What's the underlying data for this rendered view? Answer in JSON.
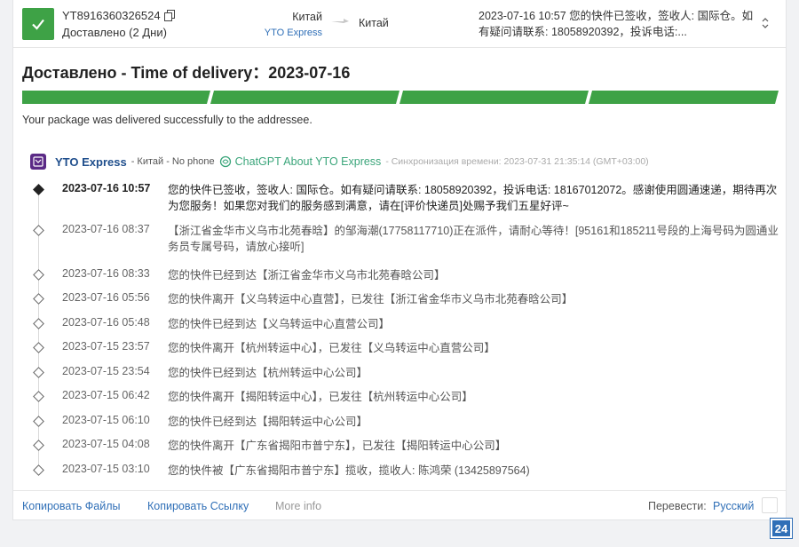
{
  "header": {
    "tracking_number": "YT8916360326524",
    "status": "Доставлено (2 Дни)",
    "origin_country": "Китай",
    "carrier_link": "YTO Express",
    "destination_country": "Китай",
    "last_event": "2023-07-16 10:57  您的快件已签收，签收人: 国际仓。如有疑问请联系: 18058920392，投诉电话:..."
  },
  "summary": {
    "title": "Доставлено - Time of delivery：2023-07-16",
    "progress_segments": 5,
    "progress_color": "#3ea246",
    "message": "Your package was delivered successfully to the addressee."
  },
  "carrier": {
    "name": "YTO Express",
    "meta": "- Китай - No phone",
    "chatgpt_link": "ChatGPT About YTO Express",
    "sync": "- Синхронизация времени: 2023-07-31 21:35:14 (GMT+03:00)"
  },
  "events": [
    {
      "time": "2023-07-16 10:57",
      "desc": "您的快件已签收，签收人: 国际仓。如有疑问请联系: 18058920392，投诉电话: 18167012072。感谢使用圆通速递，期待再次为您服务！如果您对我们的服务感到满意，请在[评价快递员]处赐予我们五星好评~"
    },
    {
      "time": "2023-07-16 08:37",
      "desc": "【浙江省金华市义乌市北苑春晗】的邹海潮(17758117710)正在派件，请耐心等待！[95161和185211号段的上海号码为圆通业务员专属号码，请放心接听]"
    },
    {
      "time": "2023-07-16 08:33",
      "desc": "您的快件已经到达【浙江省金华市义乌市北苑春晗公司】"
    },
    {
      "time": "2023-07-16 05:56",
      "desc": "您的快件离开【义乌转运中心直营】，已发往【浙江省金华市义乌市北苑春晗公司】"
    },
    {
      "time": "2023-07-16 05:48",
      "desc": "您的快件已经到达【义乌转运中心直营公司】"
    },
    {
      "time": "2023-07-15 23:57",
      "desc": "您的快件离开【杭州转运中心】，已发往【义乌转运中心直营公司】"
    },
    {
      "time": "2023-07-15 23:54",
      "desc": "您的快件已经到达【杭州转运中心公司】"
    },
    {
      "time": "2023-07-15 06:42",
      "desc": "您的快件离开【揭阳转运中心】，已发往【杭州转运中心公司】"
    },
    {
      "time": "2023-07-15 06:10",
      "desc": "您的快件已经到达【揭阳转运中心公司】"
    },
    {
      "time": "2023-07-15 04:08",
      "desc": "您的快件离开【广东省揭阳市普宁东】，已发往【揭阳转运中心公司】"
    },
    {
      "time": "2023-07-15 03:10",
      "desc": "您的快件被【广东省揭阳市普宁东】揽收，揽收人: 陈鸿荣 (13425897564)"
    }
  ],
  "footer": {
    "copy_files": "Копировать Файлы",
    "copy_link": "Копировать Ссылку",
    "more_info": "More info",
    "translate_label": "Перевести:",
    "translate_lang": "Русский"
  },
  "corner_badge": "24",
  "icons": {
    "status": "check-icon",
    "copy": "copy-icon",
    "route": "arrow-right-icon",
    "expand": "chevron-updown-icon",
    "carrier_logo": "yto-logo-icon",
    "chatgpt": "chatgpt-icon"
  }
}
